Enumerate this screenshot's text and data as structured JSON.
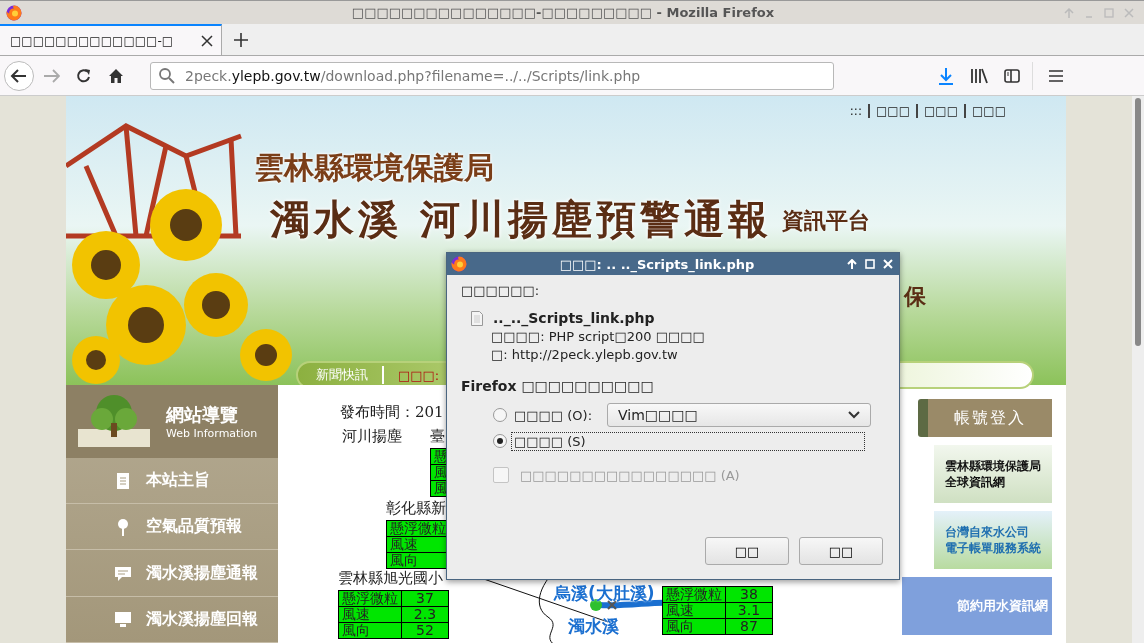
{
  "window": {
    "title": "□□□□□□□□□□□□□□□-□□□□□□□□□ - Mozilla Firefox"
  },
  "tabs": [
    {
      "label": "□□□□□□□□□□□□□-□",
      "selected": true
    }
  ],
  "url": {
    "parts": [
      {
        "text": "2peck.",
        "kind": "dim"
      },
      {
        "text": "ylepb.gov.tw",
        "kind": "host"
      },
      {
        "text": "/download.php?filename=../../Scripts/link.php",
        "kind": "dim"
      }
    ]
  },
  "page": {
    "top_links": [
      ":::",
      "□□□",
      "□□□",
      "□□□"
    ],
    "banner": {
      "agency": "雲林縣環境保護局",
      "title": "濁水溪 河川揚塵預警通報",
      "subtitle": "資訊平台",
      "fragment": "保"
    },
    "news": {
      "label": "新聞快訊",
      "text": "□□□:"
    },
    "sidebar": {
      "title": "網站導覽",
      "subtitle": "Web Information",
      "items": [
        {
          "label": "本站主旨"
        },
        {
          "label": "空氣品質預報"
        },
        {
          "label": "濁水溪揚塵通報"
        },
        {
          "label": "濁水溪揚塵回報"
        }
      ]
    },
    "bulletin": {
      "published": "發布時間：201",
      "heading": "河川揚塵",
      "stations": [
        {
          "name": "臺",
          "rows": [
            [
              "懸"
            ],
            [
              "風"
            ],
            [
              "風"
            ]
          ]
        },
        {
          "name": "彰化縣新",
          "rows": [
            [
              "懸浮微粒"
            ],
            [
              "風速"
            ],
            [
              "風向"
            ]
          ]
        },
        {
          "name": "雲林縣旭光國小",
          "rows": [
            [
              "懸浮微粒",
              "37"
            ],
            [
              "風速",
              "2.3"
            ],
            [
              "風向",
              "52"
            ]
          ]
        },
        {
          "rows": [
            [
              "懸浮微粒",
              "38"
            ],
            [
              "風速",
              "3.1"
            ],
            [
              "風向",
              "87"
            ]
          ]
        }
      ],
      "map_labels": [
        "烏溪(大肚溪)",
        "濁水溪"
      ]
    },
    "login_button": "帳號登入",
    "banners": [
      {
        "lines": [
          "雲林縣環境保護局",
          "全球資訊網"
        ],
        "kind": "green"
      },
      {
        "lines": [
          "台灣自來水公司",
          "電子帳單服務系統"
        ],
        "kind": "water"
      },
      {
        "lines": [
          "節約用水資訊網"
        ],
        "kind": "blue"
      }
    ]
  },
  "dialog": {
    "title": "□□□: .. .._Scripts_link.php",
    "prompt": "□□□□□□:",
    "file_name": ".._.._Scripts_link.php",
    "file_type": "□□□□: PHP script□200 □□□□",
    "source": "□: http://2peck.ylepb.gov.tw",
    "question": "Firefox □□□□□□□□□□",
    "options": [
      {
        "kind": "radio",
        "label": "□□□□ (O):",
        "selected": false,
        "focused": false,
        "app": "Vim□□□□"
      },
      {
        "kind": "radio",
        "label": "□□□□ (S)",
        "selected": true,
        "focused": true
      },
      {
        "kind": "checkbox",
        "label": "□□□□□□□□□□□□□□□□ (A)",
        "checked": false,
        "disabled": true
      }
    ],
    "buttons": [
      "□□",
      "□□"
    ]
  }
}
